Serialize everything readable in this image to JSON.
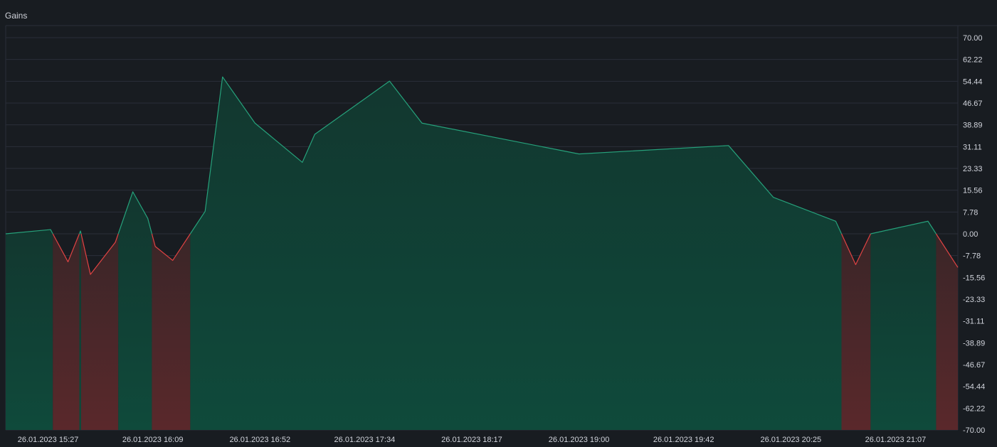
{
  "chart_data": {
    "type": "area",
    "title": "Gains",
    "xlabel": "",
    "ylabel": "",
    "ylim": [
      -70.0,
      70.0
    ],
    "y_ticks": [
      "70.00",
      "62.22",
      "54.44",
      "46.67",
      "38.89",
      "31.11",
      "23.33",
      "15.56",
      "7.78",
      "0.00",
      "-7.78",
      "-15.56",
      "-23.33",
      "-31.11",
      "-38.89",
      "-46.67",
      "-54.44",
      "-62.22",
      "-70.00"
    ],
    "x_ticks": [
      "26.01.2023 15:27",
      "26.01.2023 16:09",
      "26.01.2023 16:52",
      "26.01.2023 17:34",
      "26.01.2023 18:17",
      "26.01.2023 19:00",
      "26.01.2023 19:42",
      "26.01.2023 20:25",
      "26.01.2023 21:07"
    ],
    "x_range": [
      "26.01.2023 15:10",
      "26.01.2023 21:32"
    ],
    "grid": true,
    "legend": "none",
    "series": [
      {
        "x": [
          "26.01.2023 15:10",
          "26.01.2023 15:28",
          "26.01.2023 15:35",
          "26.01.2023 15:40",
          "26.01.2023 15:44",
          "26.01.2023 15:54",
          "26.01.2023 16:01",
          "26.01.2023 16:07",
          "26.01.2023 16:10",
          "26.01.2023 16:17",
          "26.01.2023 16:30",
          "26.01.2023 16:37",
          "26.01.2023 16:50",
          "26.01.2023 17:09",
          "26.01.2023 17:14",
          "26.01.2023 17:44",
          "26.01.2023 17:57",
          "26.01.2023 19:00",
          "26.01.2023 20:00",
          "26.01.2023 20:18",
          "26.01.2023 20:43",
          "26.01.2023 20:51",
          "26.01.2023 20:57",
          "26.01.2023 21:20",
          "26.01.2023 21:32"
        ],
        "values": [
          0.0,
          1.5,
          -10.0,
          1.0,
          -14.5,
          -3.0,
          15.0,
          5.5,
          -4.5,
          -9.5,
          8.0,
          56.0,
          39.5,
          25.5,
          35.5,
          54.5,
          39.5,
          28.5,
          31.5,
          13.0,
          4.5,
          -11.0,
          0.0,
          4.5,
          -12.0
        ]
      }
    ],
    "colors": {
      "positive_line": "#26a17b",
      "positive_fill": "#114237",
      "negative_line": "#e04343",
      "negative_fill": "#552a2c",
      "grid": "#2a2e39",
      "background": "#181c21"
    }
  }
}
